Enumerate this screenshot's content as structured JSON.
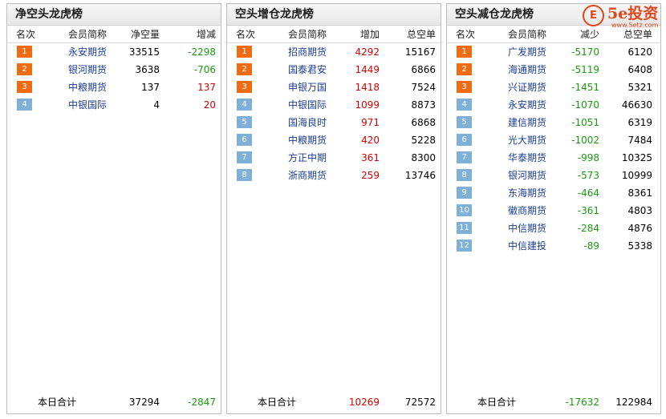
{
  "panels": [
    {
      "title": "净空头龙虎榜",
      "headers": [
        "名次",
        "会员简称",
        "净空量",
        "增减"
      ],
      "rows": [
        {
          "rank": "1",
          "name": "永安期货",
          "v1": "33515",
          "v2": "-2298",
          "tone": "hot",
          "c1": "",
          "c2": "green"
        },
        {
          "rank": "2",
          "name": "银河期货",
          "v1": "3638",
          "v2": "-706",
          "tone": "hot",
          "c1": "",
          "c2": "green"
        },
        {
          "rank": "3",
          "name": "中粮期货",
          "v1": "137",
          "v2": "137",
          "tone": "hot",
          "c1": "",
          "c2": "red"
        },
        {
          "rank": "4",
          "name": "中银国际",
          "v1": "4",
          "v2": "20",
          "tone": "cold",
          "c1": "",
          "c2": "red"
        }
      ],
      "total": {
        "label": "本日合计",
        "v1": "37294",
        "v2": "-2847",
        "c1": "",
        "c2": "green"
      }
    },
    {
      "title": "空头增仓龙虎榜",
      "headers": [
        "名次",
        "会员简称",
        "增加",
        "总空单"
      ],
      "rows": [
        {
          "rank": "1",
          "name": "招商期货",
          "v1": "4292",
          "v2": "15167",
          "tone": "hot",
          "c1": "red",
          "c2": ""
        },
        {
          "rank": "2",
          "name": "国泰君安",
          "v1": "1449",
          "v2": "6866",
          "tone": "hot",
          "c1": "red",
          "c2": ""
        },
        {
          "rank": "3",
          "name": "申银万国",
          "v1": "1418",
          "v2": "7524",
          "tone": "hot",
          "c1": "red",
          "c2": ""
        },
        {
          "rank": "4",
          "name": "中银国际",
          "v1": "1099",
          "v2": "8873",
          "tone": "cold",
          "c1": "red",
          "c2": ""
        },
        {
          "rank": "5",
          "name": "国海良时",
          "v1": "971",
          "v2": "6868",
          "tone": "cold",
          "c1": "red",
          "c2": ""
        },
        {
          "rank": "6",
          "name": "中粮期货",
          "v1": "420",
          "v2": "5228",
          "tone": "cold",
          "c1": "red",
          "c2": ""
        },
        {
          "rank": "7",
          "name": "方正中期",
          "v1": "361",
          "v2": "8300",
          "tone": "cold",
          "c1": "red",
          "c2": ""
        },
        {
          "rank": "8",
          "name": "浙商期货",
          "v1": "259",
          "v2": "13746",
          "tone": "cold",
          "c1": "red",
          "c2": ""
        }
      ],
      "total": {
        "label": "本日合计",
        "v1": "10269",
        "v2": "72572",
        "c1": "red",
        "c2": ""
      }
    },
    {
      "title": "空头减仓龙虎榜",
      "headers": [
        "名次",
        "会员简称",
        "减少",
        "总空单"
      ],
      "rows": [
        {
          "rank": "1",
          "name": "广发期货",
          "v1": "-5170",
          "v2": "6120",
          "tone": "hot",
          "c1": "green",
          "c2": ""
        },
        {
          "rank": "2",
          "name": "海通期货",
          "v1": "-5119",
          "v2": "6408",
          "tone": "hot",
          "c1": "green",
          "c2": ""
        },
        {
          "rank": "3",
          "name": "兴证期货",
          "v1": "-1451",
          "v2": "5321",
          "tone": "hot",
          "c1": "green",
          "c2": ""
        },
        {
          "rank": "4",
          "name": "永安期货",
          "v1": "-1070",
          "v2": "46630",
          "tone": "cold",
          "c1": "green",
          "c2": ""
        },
        {
          "rank": "5",
          "name": "建信期货",
          "v1": "-1051",
          "v2": "6319",
          "tone": "cold",
          "c1": "green",
          "c2": ""
        },
        {
          "rank": "6",
          "name": "光大期货",
          "v1": "-1002",
          "v2": "7484",
          "tone": "cold",
          "c1": "green",
          "c2": ""
        },
        {
          "rank": "7",
          "name": "华泰期货",
          "v1": "-998",
          "v2": "10325",
          "tone": "cold",
          "c1": "green",
          "c2": ""
        },
        {
          "rank": "8",
          "name": "银河期货",
          "v1": "-573",
          "v2": "10999",
          "tone": "cold",
          "c1": "green",
          "c2": ""
        },
        {
          "rank": "9",
          "name": "东海期货",
          "v1": "-464",
          "v2": "8361",
          "tone": "cold",
          "c1": "green",
          "c2": ""
        },
        {
          "rank": "10",
          "name": "徽商期货",
          "v1": "-361",
          "v2": "4803",
          "tone": "cold",
          "c1": "green",
          "c2": ""
        },
        {
          "rank": "11",
          "name": "中信期货",
          "v1": "-284",
          "v2": "4876",
          "tone": "cold",
          "c1": "green",
          "c2": ""
        },
        {
          "rank": "12",
          "name": "中信建投",
          "v1": "-89",
          "v2": "5338",
          "tone": "cold",
          "c1": "green",
          "c2": ""
        }
      ],
      "total": {
        "label": "本日合计",
        "v1": "-17632",
        "v2": "122984",
        "c1": "green",
        "c2": ""
      }
    }
  ],
  "logo": {
    "mark": "E",
    "text": "5e投资",
    "sub": "www.5etz.com",
    "color": "#e0451b"
  },
  "colors": {
    "hot_rank": "#ef6c14",
    "cold_rank": "#7fb0d8",
    "up": "#d20000",
    "down": "#1c9a12",
    "member_link": "#1b3d8f"
  }
}
